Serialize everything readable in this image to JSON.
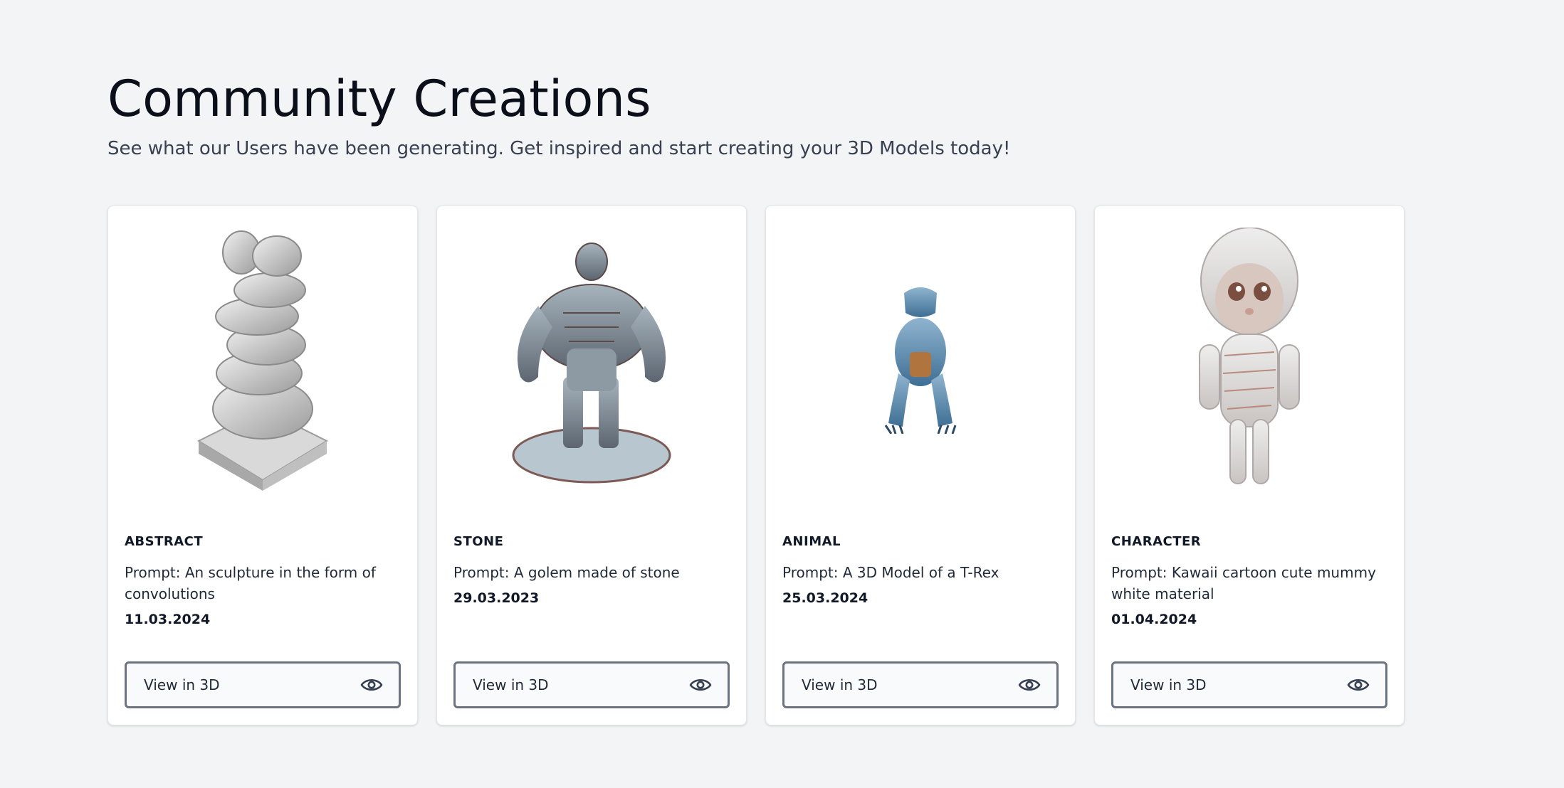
{
  "header": {
    "title": "Community Creations",
    "subtitle": "See what our Users have been generating. Get inspired and start creating your 3D Models today!"
  },
  "cards": [
    {
      "category": "ABSTRACT",
      "prompt": "Prompt: An sculpture in the form of convolutions",
      "date": "11.03.2024",
      "button_label": "View in 3D",
      "button_icon": "eye-icon",
      "image": "abstract-sculpture-model"
    },
    {
      "category": "STONE",
      "prompt": "Prompt: A golem made of stone",
      "date": "29.03.2023",
      "button_label": "View in 3D",
      "button_icon": "eye-icon",
      "image": "stone-golem-model"
    },
    {
      "category": "ANIMAL",
      "prompt": "Prompt: A 3D Model of a T-Rex",
      "date": "25.03.2024",
      "button_label": "View in 3D",
      "button_icon": "eye-icon",
      "image": "t-rex-model"
    },
    {
      "category": "CHARACTER",
      "prompt": "Prompt: Kawaii cartoon cute mummy white material",
      "date": "01.04.2024",
      "button_label": "View in 3D",
      "button_icon": "eye-icon",
      "image": "kawaii-mummy-model"
    }
  ],
  "colors": {
    "page_background": "#f3f4f6",
    "card_background": "#ffffff",
    "button_border": "#6b7280",
    "heading_text": "#0b0f1a"
  }
}
